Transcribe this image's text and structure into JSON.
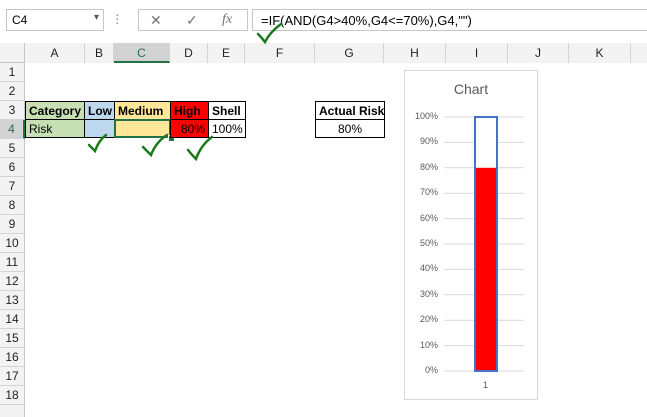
{
  "name_box": {
    "value": "C4",
    "dropdown_icon": "chevron-down-icon"
  },
  "formula_bar": {
    "cancel_icon": "cancel-x-icon",
    "enter_icon": "check-icon",
    "fx_label": "fx",
    "formula": "=IF(AND(G4>40%,G4<=70%),G4,\"\")"
  },
  "columns": [
    "A",
    "B",
    "C",
    "D",
    "E",
    "F",
    "G",
    "H",
    "I",
    "J",
    "K"
  ],
  "selected_column": "C",
  "rows": [
    "1",
    "2",
    "3",
    "4",
    "5",
    "6",
    "7",
    "8",
    "9",
    "10",
    "11",
    "12",
    "13",
    "14",
    "15",
    "16",
    "17",
    "18"
  ],
  "selected_row": "4",
  "table": {
    "headers": {
      "category": "Category",
      "low": "Low",
      "medium": "Medium",
      "high": "High",
      "shell": "Shell"
    },
    "row4": {
      "category": "Risk",
      "low": "",
      "medium": "",
      "high": "80%",
      "shell": "100%"
    }
  },
  "actual_risk": {
    "label": "Actual Risk",
    "value": "80%"
  },
  "colors": {
    "category_fill": "#c6e0b4",
    "low_fill": "#bdd7ee",
    "medium_fill": "#ffe699",
    "high_fill": "#ff0000",
    "chart_bar": "#ff0000",
    "chart_shell_border": "#4472c4",
    "annotation_check": "#1a7a1a",
    "selection": "#217346"
  },
  "annotations": {
    "check_marks": 4,
    "icon": "handwritten-check-icon"
  },
  "chart_data": {
    "type": "bar",
    "title": "Chart",
    "categories": [
      "1"
    ],
    "series": [
      {
        "values": [
          1.0
        ]
      },
      {
        "values": [
          0.8
        ]
      }
    ],
    "ylim": [
      0,
      1
    ],
    "yticks": [
      "0%",
      "10%",
      "20%",
      "30%",
      "40%",
      "50%",
      "60%",
      "70%",
      "80%",
      "90%",
      "100%"
    ],
    "grid": true
  }
}
